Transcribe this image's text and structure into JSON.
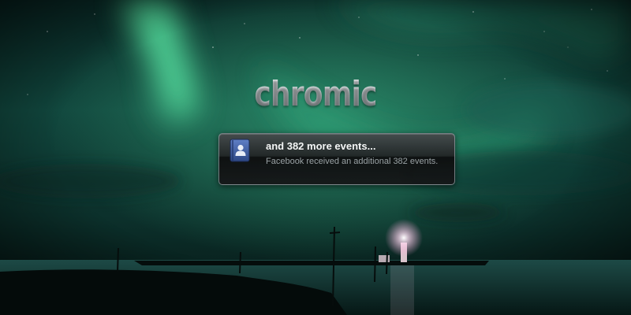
{
  "branding": {
    "app_name": "chromic"
  },
  "notification": {
    "app_icon": "facebook-contact-icon",
    "title": "and 382 more events...",
    "body": "Facebook received an additional 382 events."
  },
  "colors": {
    "sky": "#0f4a3f",
    "aurora": "#3fbf8a",
    "notification_bg": "#222526",
    "notification_icon": "#3b5998"
  }
}
